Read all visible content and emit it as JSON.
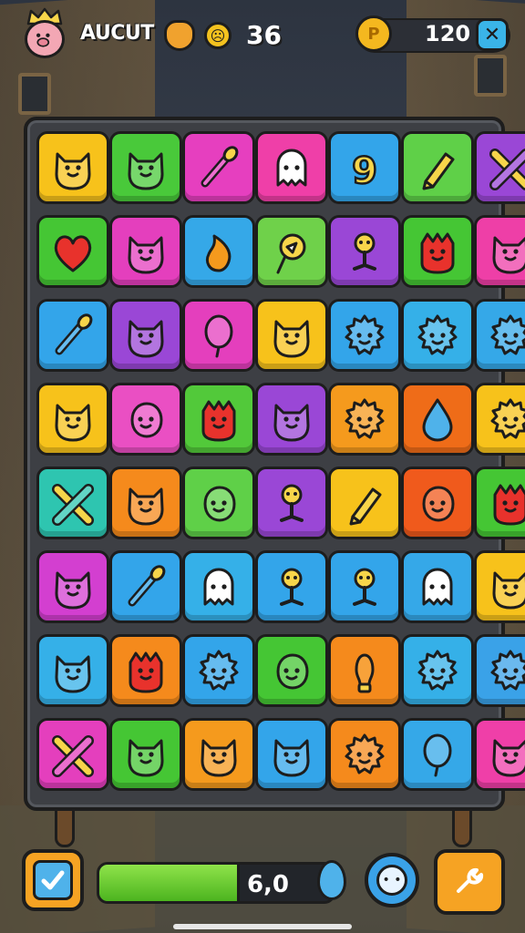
{
  "hud": {
    "player_name": "AUCUT",
    "moves": "36",
    "coins": "120",
    "coin_symbol": "P",
    "close_symbol": "✕",
    "smiley_symbol": "☹"
  },
  "board": {
    "rows": [
      [
        {
          "color": "#f7c21b",
          "icon": "cat-face"
        },
        {
          "color": "#49c93a",
          "icon": "cat-face"
        },
        {
          "color": "#e63fbf",
          "icon": "brush"
        },
        {
          "color": "#ef3fa8",
          "icon": "ghost"
        },
        {
          "color": "#33a5ea",
          "icon": "number-nine"
        },
        {
          "color": "#5fd048",
          "icon": "pencil"
        },
        {
          "color": "#9a47d6",
          "icon": "crossed-tools"
        }
      ],
      [
        {
          "color": "#45c634",
          "icon": "heart"
        },
        {
          "color": "#e43fbd",
          "icon": "cat-face"
        },
        {
          "color": "#35a8e8",
          "icon": "flame"
        },
        {
          "color": "#6fd14a",
          "icon": "ice-cream"
        },
        {
          "color": "#9a47d6",
          "icon": "stick-figure"
        },
        {
          "color": "#45c634",
          "icon": "monster"
        },
        {
          "color": "#ee3fa7",
          "icon": "cat-face"
        }
      ],
      [
        {
          "color": "#33a5ea",
          "icon": "brush"
        },
        {
          "color": "#9a47d6",
          "icon": "cat-face"
        },
        {
          "color": "#e43fbd",
          "icon": "balloon"
        },
        {
          "color": "#f7c21b",
          "icon": "cat-face"
        },
        {
          "color": "#33a5ea",
          "icon": "gear-face"
        },
        {
          "color": "#35b0e8",
          "icon": "gear-face"
        },
        {
          "color": "#35a8e8",
          "icon": "gear-face"
        }
      ],
      [
        {
          "color": "#f7c21b",
          "icon": "cat-face"
        },
        {
          "color": "#ea4fc3",
          "icon": "blob"
        },
        {
          "color": "#52c93a",
          "icon": "monster"
        },
        {
          "color": "#9a47d6",
          "icon": "cat-face"
        },
        {
          "color": "#f59a1d",
          "icon": "gear-face"
        },
        {
          "color": "#ef6c18",
          "icon": "drop"
        },
        {
          "color": "#f7c21b",
          "icon": "gear-face"
        }
      ],
      [
        {
          "color": "#2ec5b0",
          "icon": "crossed-tools"
        },
        {
          "color": "#f58a1c",
          "icon": "cat-face"
        },
        {
          "color": "#5fd048",
          "icon": "blob"
        },
        {
          "color": "#9a47d6",
          "icon": "stick-figure"
        },
        {
          "color": "#f7c21b",
          "icon": "pencil"
        },
        {
          "color": "#f05a1c",
          "icon": "blob"
        },
        {
          "color": "#45c634",
          "icon": "monster"
        }
      ],
      [
        {
          "color": "#d33fd0",
          "icon": "cat-face"
        },
        {
          "color": "#33a5ea",
          "icon": "brush"
        },
        {
          "color": "#35b0e8",
          "icon": "ghost"
        },
        {
          "color": "#33a5ea",
          "icon": "stick-figure"
        },
        {
          "color": "#33a5ea",
          "icon": "stick-figure"
        },
        {
          "color": "#35a8e8",
          "icon": "ghost"
        },
        {
          "color": "#f7c21b",
          "icon": "cat-face"
        }
      ],
      [
        {
          "color": "#35b0e8",
          "icon": "cat-face"
        },
        {
          "color": "#f58a1c",
          "icon": "monster"
        },
        {
          "color": "#33a5ea",
          "icon": "gear-face"
        },
        {
          "color": "#45c634",
          "icon": "blob"
        },
        {
          "color": "#f58a1c",
          "icon": "bulb"
        },
        {
          "color": "#35b0e8",
          "icon": "gear-face"
        },
        {
          "color": "#3aa2e8",
          "icon": "gear-face"
        }
      ],
      [
        {
          "color": "#e43fbd",
          "icon": "crossed-tools"
        },
        {
          "color": "#45c634",
          "icon": "cat-face"
        },
        {
          "color": "#f59a1d",
          "icon": "cat-face"
        },
        {
          "color": "#33a5ea",
          "icon": "cat-face"
        },
        {
          "color": "#f58a1c",
          "icon": "gear-face"
        },
        {
          "color": "#35a8e8",
          "icon": "balloon"
        },
        {
          "color": "#ef3fa8",
          "icon": "cat-face"
        }
      ]
    ]
  },
  "bottom": {
    "progress_text": "6,0",
    "progress_fraction": 0.6
  }
}
